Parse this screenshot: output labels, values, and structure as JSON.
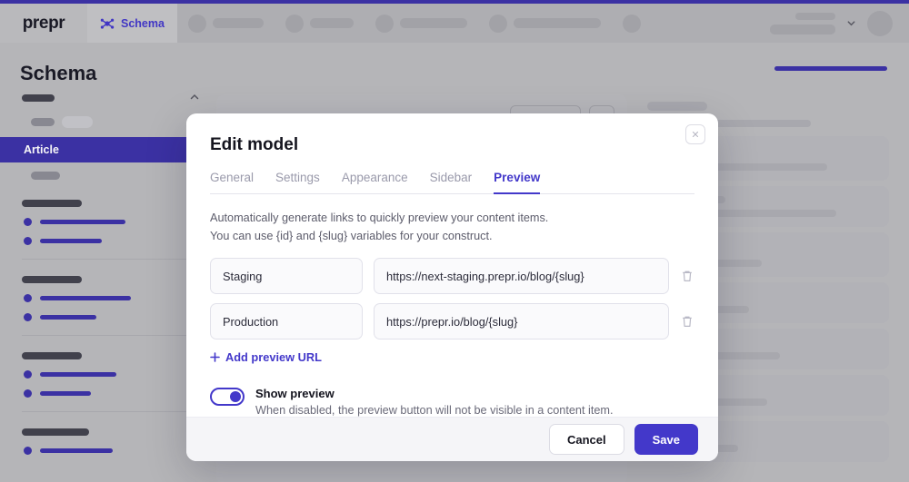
{
  "header": {
    "logo": "prepr",
    "schema_tab": {
      "label": "Schema",
      "icon": "schema-icon"
    },
    "ghost_tab_widths": [
      56,
      48,
      74,
      96,
      0
    ],
    "chevron_icon": "chevron-down-icon",
    "avatar_icon": "avatar"
  },
  "page": {
    "title": "Schema"
  },
  "sidebar": {
    "active_item": "Article",
    "caret_icon": "chevron-up-icon",
    "groups": [
      {
        "rows": [
          94,
          68
        ]
      },
      {
        "rows": [
          100,
          62
        ]
      },
      {
        "rows": [
          84,
          56
        ]
      },
      {
        "rows": [
          80
        ]
      }
    ]
  },
  "modal": {
    "title": "Edit model",
    "close_icon": "close-icon",
    "tabs": [
      {
        "label": "General",
        "active": false
      },
      {
        "label": "Settings",
        "active": false
      },
      {
        "label": "Appearance",
        "active": false
      },
      {
        "label": "Sidebar",
        "active": false
      },
      {
        "label": "Preview",
        "active": true
      }
    ],
    "description_line1": "Automatically generate links to quickly preview your content items.",
    "description_line2": "You can use {id} and {slug} variables for your construct.",
    "preview_urls": [
      {
        "name": "Staging",
        "url": "https://next-staging.prepr.io/blog/{slug}",
        "delete_icon": "trash-icon"
      },
      {
        "name": "Production",
        "url": "https://prepr.io/blog/{slug}",
        "delete_icon": "trash-icon"
      }
    ],
    "add_url_label": "Add preview URL",
    "add_url_icon": "plus-icon",
    "toggle": {
      "label": "Show preview",
      "help": "When disabled, the preview button will not be visible in a content item.",
      "enabled": true
    },
    "footer": {
      "cancel_label": "Cancel",
      "save_label": "Save"
    }
  },
  "colors": {
    "accent": "#4338ca",
    "accent_dark": "#3d32a8",
    "page_bg": "#bcbcbe",
    "modal_bg": "#ffffff"
  }
}
